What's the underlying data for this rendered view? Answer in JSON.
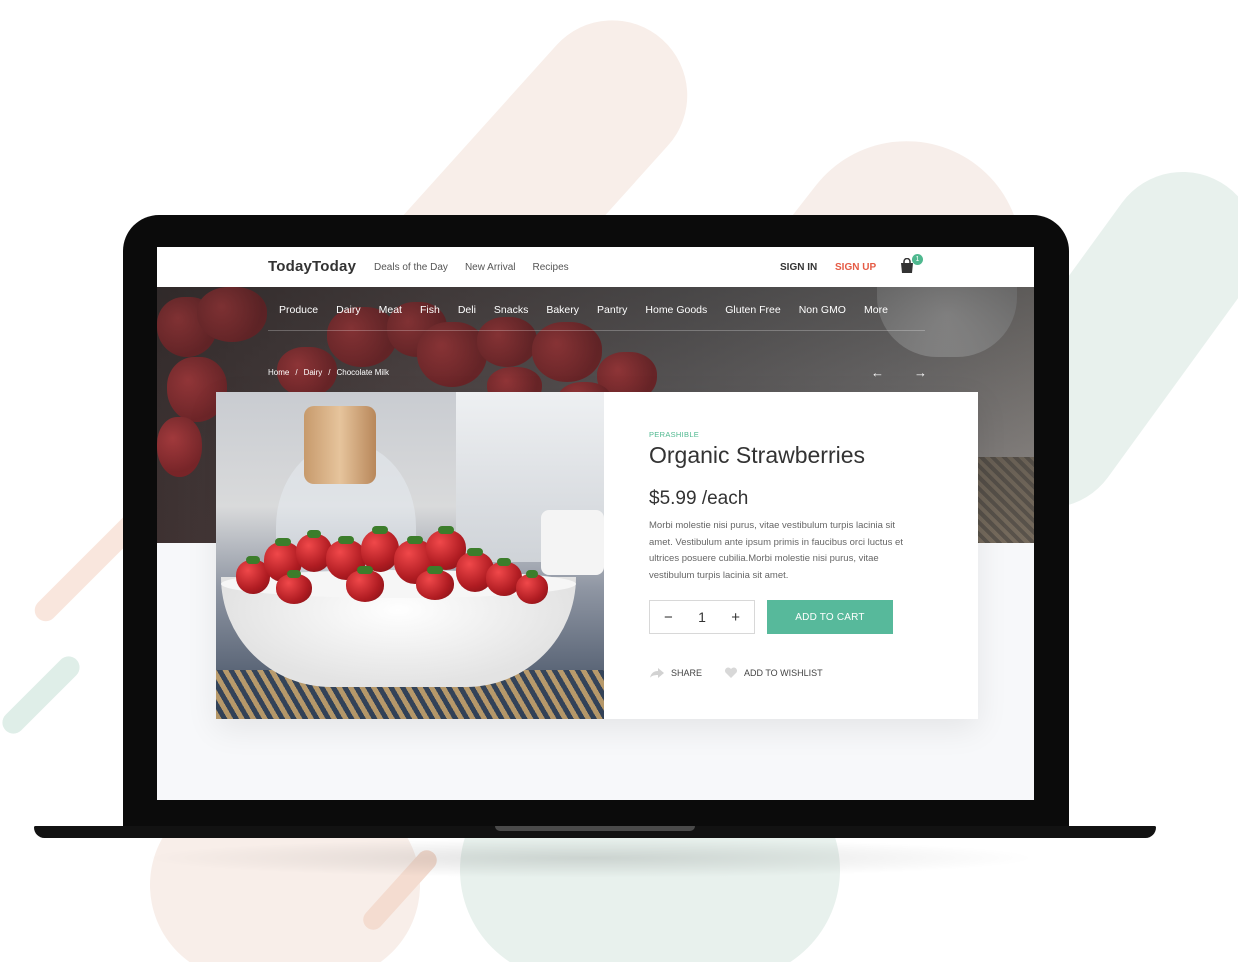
{
  "header": {
    "logo": "TodayToday",
    "nav": [
      "Deals of the Day",
      "New Arrival",
      "Recipes"
    ],
    "sign_in": "SIGN IN",
    "sign_up": "SIGN UP",
    "cart_count": "1",
    "cart_icon": "shopping-bag-icon"
  },
  "categories": [
    "Produce",
    "Dairy",
    "Meat",
    "Fish",
    "Deli",
    "Snacks",
    "Bakery",
    "Pantry",
    "Home Goods",
    "Gluten Free",
    "Non GMO",
    "More"
  ],
  "breadcrumb": [
    "Home",
    "Dairy",
    "Chocolate Milk"
  ],
  "breadcrumb_separator": "/",
  "pager": {
    "prev": "←",
    "next": "→"
  },
  "product": {
    "tag": "PERASHIBLE",
    "name": "Organic Strawberries",
    "price": "$5.99 /each",
    "description": "Morbi molestie nisi purus, vitae vestibulum turpis lacinia sit amet. Vestibulum ante ipsum primis in faucibus orci luctus et ultrices posuere cubilia.Morbi molestie nisi purus, vitae vestibulum turpis lacinia sit amet.",
    "quantity": "1",
    "minus": "−",
    "plus": "+",
    "add_to_cart": "ADD TO CART",
    "share": "SHARE",
    "wishlist": "ADD TO WISHLIST"
  },
  "colors": {
    "accent": "#57b99b",
    "signup": "#e55b45",
    "tag": "#4fb88f"
  }
}
